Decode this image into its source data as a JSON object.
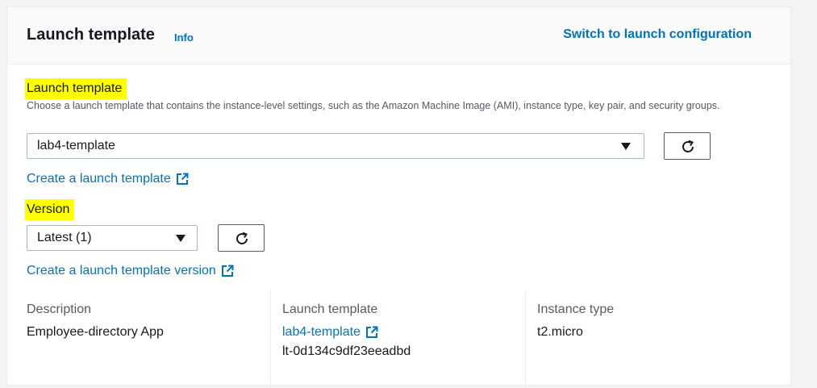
{
  "header": {
    "title": "Launch template",
    "info_label": "Info",
    "switch_label": "Switch to launch configuration"
  },
  "launch_template_field": {
    "label": "Launch template",
    "description": "Choose a launch template that contains the instance-level settings, such as the Amazon Machine Image (AMI), instance type, key pair, and security groups.",
    "selected": "lab4-template",
    "create_link": "Create a launch template"
  },
  "version_field": {
    "label": "Version",
    "selected": "Latest (1)",
    "create_link": "Create a launch template version"
  },
  "details": {
    "description": {
      "label": "Description",
      "value": "Employee-directory App"
    },
    "launch_template": {
      "label": "Launch template",
      "name": "lab4-template",
      "id": "lt-0d134c9df23eeadbd"
    },
    "instance_type": {
      "label": "Instance type",
      "value": "t2.micro"
    }
  },
  "icons": [
    "refresh-icon",
    "external-link-icon",
    "caret-down-icon"
  ],
  "colors": {
    "link": "#0073bb",
    "highlight": "#ffff00",
    "text": "#16191f",
    "muted": "#545b64"
  }
}
